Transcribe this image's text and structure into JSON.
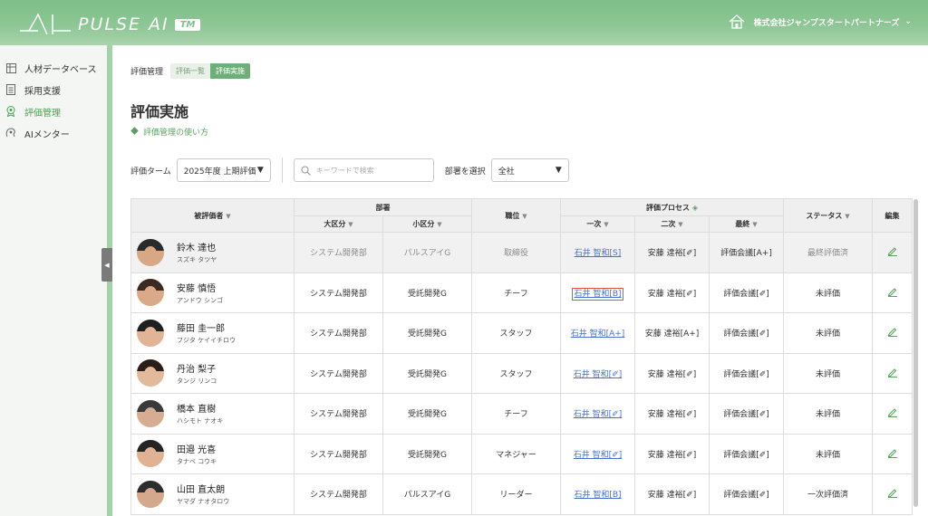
{
  "app": {
    "name": "PULSE AI",
    "tm": "TM"
  },
  "header": {
    "company": "株式会社ジャンプスタートパートナーズ",
    "home_icon": "home-icon"
  },
  "sidebar": {
    "items": [
      {
        "label": "人材データベース",
        "icon": "database-icon",
        "active": false
      },
      {
        "label": "採用支援",
        "icon": "document-icon",
        "active": false
      },
      {
        "label": "評価管理",
        "icon": "award-icon",
        "active": true
      },
      {
        "label": "AIメンター",
        "icon": "mentor-icon",
        "active": false
      }
    ],
    "collapse_glyph": "◀"
  },
  "breadcrumb": {
    "label": "評価管理",
    "tabs": [
      "評価一覧",
      "評価実施"
    ]
  },
  "page": {
    "title": "評価実施",
    "howto": "評価管理の使い方"
  },
  "filters": {
    "term_label": "評価ターム",
    "term_value": "2025年度 上期評価",
    "search_placeholder": "キーワードで検索",
    "dept_label": "部署を選択",
    "dept_value": "全社"
  },
  "table": {
    "headers": {
      "evaluatee": "被評価者",
      "dept": "部署",
      "dept_major": "大区分",
      "dept_minor": "小区分",
      "position": "職位",
      "process": "評価プロセス",
      "first": "一次",
      "second": "二次",
      "final": "最終",
      "status": "ステータス",
      "edit": "編集"
    },
    "rows": [
      {
        "name": "鈴木 達也",
        "kana": "スズキ タツヤ",
        "major": "システム開発部",
        "minor": "パルスアイG",
        "position": "取締役",
        "first": "石井 智和[S]",
        "second": "安藤 達裕[✐]",
        "final": "評価会議[A+]",
        "status": "最終評価済",
        "done": true
      },
      {
        "name": "安藤 慎悟",
        "kana": "アンドウ シンゴ",
        "major": "システム開発部",
        "minor": "受託開発G",
        "position": "チーフ",
        "first": "石井 智和[B]",
        "second": "安藤 達裕[✐]",
        "final": "評価会議[✐]",
        "status": "未評価",
        "done": false
      },
      {
        "name": "藤田 圭一郎",
        "kana": "フジタ ケイイチロウ",
        "major": "システム開発部",
        "minor": "受託開発G",
        "position": "スタッフ",
        "first": "石井 智和[A+]",
        "second": "安藤 達裕[A+]",
        "final": "評価会議[✐]",
        "status": "未評価",
        "done": false
      },
      {
        "name": "丹治 梨子",
        "kana": "タンジ リンコ",
        "major": "システム開発部",
        "minor": "受託開発G",
        "position": "スタッフ",
        "first": "石井 智和[✐]",
        "second": "安藤 達裕[✐]",
        "final": "評価会議[✐]",
        "status": "未評価",
        "done": false
      },
      {
        "name": "橋本 直樹",
        "kana": "ハシモト ナオキ",
        "major": "システム開発部",
        "minor": "受託開発G",
        "position": "チーフ",
        "first": "石井 智和[✐]",
        "second": "安藤 達裕[✐]",
        "final": "評価会議[✐]",
        "status": "未評価",
        "done": false
      },
      {
        "name": "田邉 光喜",
        "kana": "タナベ コウキ",
        "major": "システム開発部",
        "minor": "受託開発G",
        "position": "マネジャー",
        "first": "石井 智和[✐]",
        "second": "安藤 達裕[✐]",
        "final": "評価会議[✐]",
        "status": "未評価",
        "done": false
      },
      {
        "name": "山田 直太朗",
        "kana": "ヤマダ ナオタロウ",
        "major": "システム開発部",
        "minor": "パルスアイG",
        "position": "リーダー",
        "first": "石井 智和[B]",
        "second": "安藤 達裕[✐]",
        "final": "評価会議[✐]",
        "status": "一次評価済",
        "done": false
      }
    ]
  },
  "colors": {
    "brand_green": "#7fbe88",
    "accent_green": "#5a9e62",
    "link_blue": "#4a72c8",
    "highlight_red": "#e0533c"
  }
}
